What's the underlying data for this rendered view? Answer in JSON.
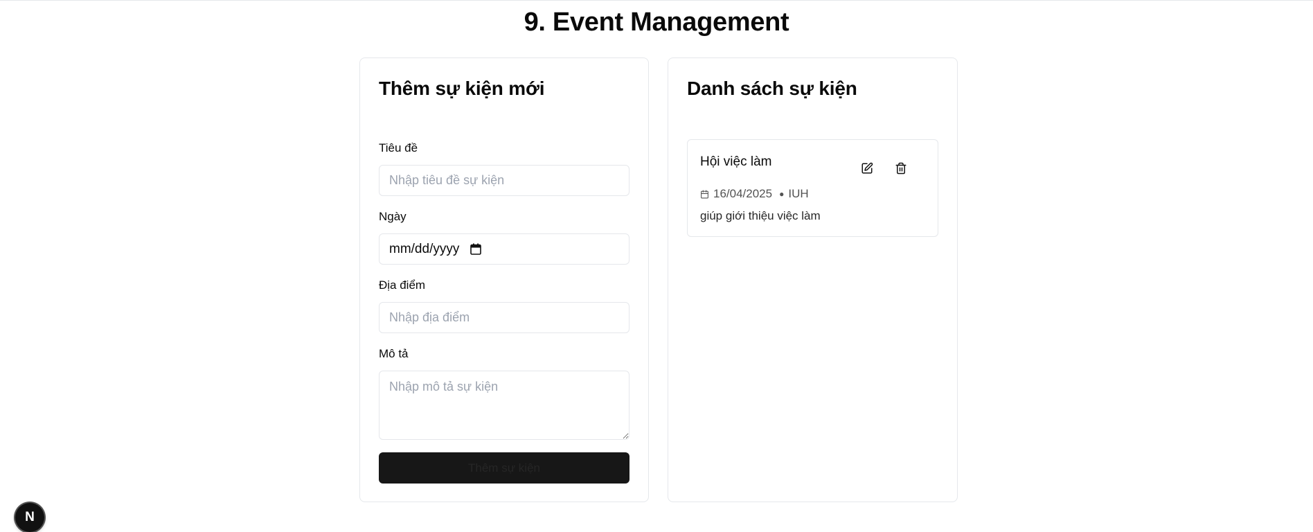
{
  "page": {
    "title": "9. Event Management"
  },
  "form": {
    "title": "Thêm sự kiện mới",
    "title_label": "Tiêu đề",
    "title_placeholder": "Nhập tiêu đề sự kiện",
    "date_label": "Ngày",
    "date_value": "mm/dd/yyyy",
    "location_label": "Địa điểm",
    "location_placeholder": "Nhập địa điểm",
    "description_label": "Mô tả",
    "description_placeholder": "Nhập mô tả sự kiện",
    "submit_label": "Thêm sự kiện"
  },
  "list": {
    "title": "Danh sách sự kiện",
    "events": [
      {
        "title": "Hội việc làm",
        "date": "16/04/2025",
        "location": "IUH",
        "description": "giúp giới thiệu việc làm"
      }
    ]
  },
  "badge": {
    "letter": "N"
  },
  "icons": {
    "calendar": "calendar-icon",
    "edit": "edit-icon",
    "delete": "trash-icon"
  }
}
